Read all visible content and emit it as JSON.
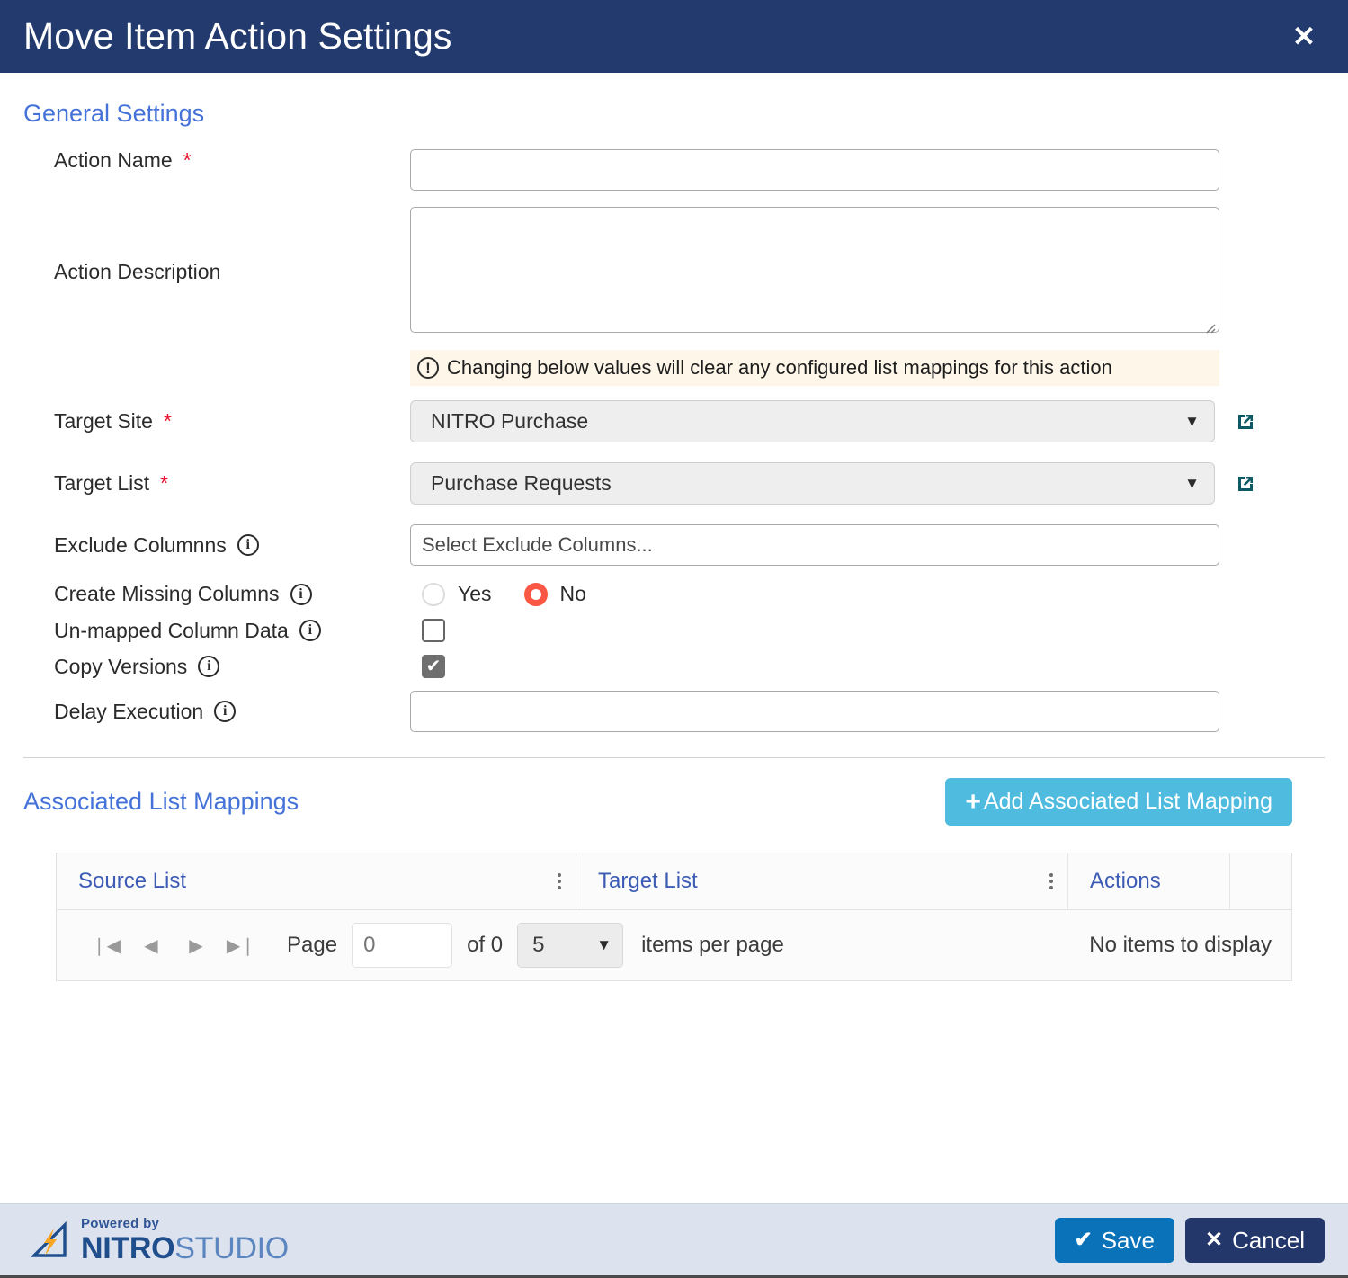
{
  "dialog": {
    "title": "Move Item Action Settings",
    "close_label": "✕"
  },
  "general": {
    "section_title": "General Settings",
    "action_name": {
      "label": "Action Name",
      "required_mark": "*",
      "value": "",
      "placeholder": ""
    },
    "action_description": {
      "label": "Action Description",
      "value": "",
      "placeholder": ""
    },
    "warning": {
      "icon": "exclamation-circle-icon",
      "text": "Changing below values will clear any configured list mappings for this action"
    },
    "target_site": {
      "label": "Target Site",
      "required_mark": "*",
      "value": "NITRO Purchase",
      "caret": "▼",
      "open_link_icon": "external-link-icon"
    },
    "target_list": {
      "label": "Target List",
      "required_mark": "*",
      "value": "Purchase Requests",
      "caret": "▼",
      "open_link_icon": "external-link-icon"
    },
    "exclude_columns": {
      "label": "Exclude Columnns",
      "info_icon": "info-icon",
      "value": "",
      "placeholder": "Select Exclude Columns..."
    },
    "create_missing_columns": {
      "label": "Create Missing Columns",
      "info_icon": "info-icon",
      "options": [
        "Yes",
        "No"
      ],
      "selected": "No"
    },
    "unmapped_column_data": {
      "label": "Un-mapped Column Data",
      "info_icon": "info-icon",
      "checked": false,
      "check_glyph": "✔"
    },
    "copy_versions": {
      "label": "Copy Versions",
      "info_icon": "info-icon",
      "checked": true,
      "check_glyph": "✔"
    },
    "delay_execution": {
      "label": "Delay Execution",
      "info_icon": "info-icon",
      "value": "",
      "placeholder": ""
    }
  },
  "mappings": {
    "section_title": "Associated List Mappings",
    "add_button": {
      "plus": "+",
      "label": "Add Associated List Mapping"
    },
    "columns": [
      "Source List",
      "Target List",
      "Actions"
    ],
    "rows": [],
    "empty_text": "No items to display",
    "pager": {
      "first": "❘◀",
      "prev": "◀",
      "next": "▶",
      "last": "▶❘",
      "page_label": "Page",
      "page_value": "0",
      "page_placeholder": "0",
      "of_label": "of 0",
      "page_size": "5",
      "page_size_caret": "▼",
      "items_per_page_label": "items per page"
    }
  },
  "footer": {
    "logo": {
      "powered_by": "Powered by",
      "brand_bold": "NITRO",
      "brand_light": "STUDIO"
    },
    "save": {
      "glyph": "✔",
      "label": "Save"
    },
    "cancel": {
      "glyph": "✕",
      "label": "Cancel"
    }
  },
  "colors": {
    "titlebar": "#223a6d",
    "section_heading": "#4472d8",
    "accent_add_button": "#4fbbdf",
    "save_button": "#0a72b9",
    "cancel_button": "#23376b",
    "radio_selected": "#fb5745",
    "warning_background": "#fdf6e9",
    "footer_background": "#dce2ee",
    "required_asterisk": "#e8102b",
    "external_link_icon": "#0d5a66"
  }
}
